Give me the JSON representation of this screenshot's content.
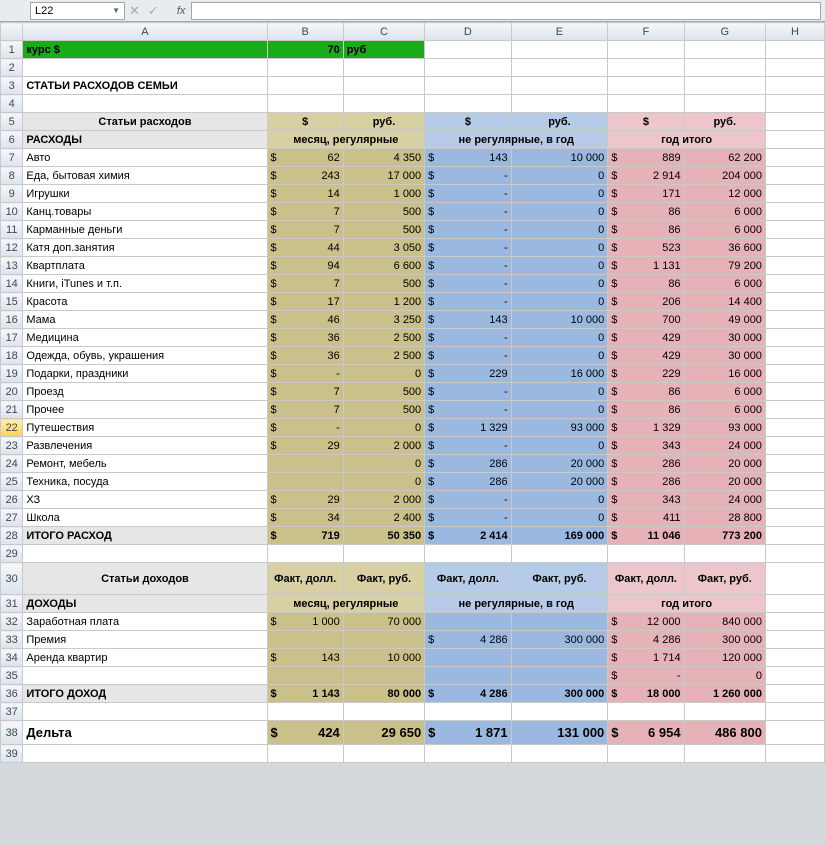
{
  "formulaBar": {
    "cellRef": "L22",
    "fx": "fx",
    "value": ""
  },
  "columns": [
    "A",
    "B",
    "C",
    "D",
    "E",
    "F",
    "G",
    "H"
  ],
  "row1": {
    "a": "курс $",
    "b": "70",
    "c": "руб"
  },
  "row3": {
    "a": "СТАТЬИ РАСХОДОВ СЕМЬИ"
  },
  "hdr_exp": {
    "a": "Статьи расходов",
    "b": "$",
    "c": "руб.",
    "d": "$",
    "e": "руб.",
    "f": "$",
    "g": "руб."
  },
  "section_exp": {
    "a": "РАСХОДЫ",
    "bc": "месяц, регулярные",
    "de": "не регулярные, в год",
    "fg": "год итого"
  },
  "expenses": [
    {
      "r": 7,
      "a": "Авто",
      "b": "62",
      "c": "4 350",
      "d": "143",
      "e": "10 000",
      "f": "889",
      "g": "62 200"
    },
    {
      "r": 8,
      "a": "Еда, бытовая химия",
      "b": "243",
      "c": "17 000",
      "d": "-",
      "e": "0",
      "f": "2 914",
      "g": "204 000"
    },
    {
      "r": 9,
      "a": "Игрушки",
      "b": "14",
      "c": "1 000",
      "d": "-",
      "e": "0",
      "f": "171",
      "g": "12 000"
    },
    {
      "r": 10,
      "a": "Канц.товары",
      "b": "7",
      "c": "500",
      "d": "-",
      "e": "0",
      "f": "86",
      "g": "6 000"
    },
    {
      "r": 11,
      "a": "Карманные деньги",
      "b": "7",
      "c": "500",
      "d": "-",
      "e": "0",
      "f": "86",
      "g": "6 000"
    },
    {
      "r": 12,
      "a": "Катя доп.занятия",
      "b": "44",
      "c": "3 050",
      "d": "-",
      "e": "0",
      "f": "523",
      "g": "36 600"
    },
    {
      "r": 13,
      "a": "Квартплата",
      "b": "94",
      "c": "6 600",
      "d": "-",
      "e": "0",
      "f": "1 131",
      "g": "79 200"
    },
    {
      "r": 14,
      "a": "Книги, iTunes и т.п.",
      "b": "7",
      "c": "500",
      "d": "-",
      "e": "0",
      "f": "86",
      "g": "6 000"
    },
    {
      "r": 15,
      "a": "Красота",
      "b": "17",
      "c": "1 200",
      "d": "-",
      "e": "0",
      "f": "206",
      "g": "14 400"
    },
    {
      "r": 16,
      "a": "Мама",
      "b": "46",
      "c": "3 250",
      "d": "143",
      "e": "10 000",
      "f": "700",
      "g": "49 000"
    },
    {
      "r": 17,
      "a": "Медицина",
      "b": "36",
      "c": "2 500",
      "d": "-",
      "e": "0",
      "f": "429",
      "g": "30 000"
    },
    {
      "r": 18,
      "a": "Одежда, обувь, украшения",
      "b": "36",
      "c": "2 500",
      "d": "-",
      "e": "0",
      "f": "429",
      "g": "30 000"
    },
    {
      "r": 19,
      "a": "Подарки, праздники",
      "b": "-",
      "c": "0",
      "d": "229",
      "e": "16 000",
      "f": "229",
      "g": "16 000"
    },
    {
      "r": 20,
      "a": "Проезд",
      "b": "7",
      "c": "500",
      "d": "-",
      "e": "0",
      "f": "86",
      "g": "6 000"
    },
    {
      "r": 21,
      "a": "Прочее",
      "b": "7",
      "c": "500",
      "d": "-",
      "e": "0",
      "f": "86",
      "g": "6 000"
    },
    {
      "r": 22,
      "a": "Путешествия",
      "b": "-",
      "c": "0",
      "d": "1 329",
      "e": "93 000",
      "f": "1 329",
      "g": "93 000",
      "active": true
    },
    {
      "r": 23,
      "a": "Развлечения",
      "b": "29",
      "c": "2 000",
      "d": "-",
      "e": "0",
      "f": "343",
      "g": "24 000"
    },
    {
      "r": 24,
      "a": "Ремонт, мебель",
      "b": "",
      "c": "0",
      "d": "286",
      "e": "20 000",
      "f": "286",
      "g": "20 000"
    },
    {
      "r": 25,
      "a": "Техника, посуда",
      "b": "",
      "c": "0",
      "d": "286",
      "e": "20 000",
      "f": "286",
      "g": "20 000"
    },
    {
      "r": 26,
      "a": "ХЗ",
      "b": "29",
      "c": "2 000",
      "d": "-",
      "e": "0",
      "f": "343",
      "g": "24 000"
    },
    {
      "r": 27,
      "a": "Школа",
      "b": "34",
      "c": "2 400",
      "d": "-",
      "e": "0",
      "f": "411",
      "g": "28 800"
    }
  ],
  "exp_total": {
    "r": 28,
    "a": "ИТОГО РАСХОД",
    "b": "719",
    "c": "50 350",
    "d": "2 414",
    "e": "169 000",
    "f": "11 046",
    "g": "773 200"
  },
  "hdr_inc": {
    "a": "Статьи доходов",
    "b": "Факт, долл.",
    "c": "Факт, руб.",
    "d": "Факт, долл.",
    "e": "Факт, руб.",
    "f": "Факт, долл.",
    "g": "Факт, руб."
  },
  "section_inc": {
    "a": "ДОХОДЫ",
    "bc": "месяц, регулярные",
    "de": "не регулярные, в год",
    "fg": "год итого"
  },
  "income": [
    {
      "r": 32,
      "a": "Заработная плата",
      "b": "1 000",
      "c": "70 000",
      "d": "",
      "e": "",
      "f": "12 000",
      "g": "840 000"
    },
    {
      "r": 33,
      "a": "Премия",
      "b": "",
      "c": "",
      "d": "4 286",
      "e": "300 000",
      "f": "4 286",
      "g": "300 000"
    },
    {
      "r": 34,
      "a": "Аренда квартир",
      "b": "143",
      "c": "10 000",
      "d": "",
      "e": "",
      "f": "1 714",
      "g": "120 000"
    },
    {
      "r": 35,
      "a": "",
      "b": "",
      "c": "",
      "d": "",
      "e": "",
      "f": "-",
      "g": "0"
    }
  ],
  "inc_total": {
    "r": 36,
    "a": "ИТОГО ДОХОД",
    "b": "1 143",
    "c": "80 000",
    "d": "4 286",
    "e": "300 000",
    "f": "18 000",
    "g": "1 260 000"
  },
  "delta": {
    "r": 38,
    "a": "Дельта",
    "b": "424",
    "c": "29 650",
    "d": "1 871",
    "e": "131 000",
    "f": "6 954",
    "g": "486 800"
  }
}
